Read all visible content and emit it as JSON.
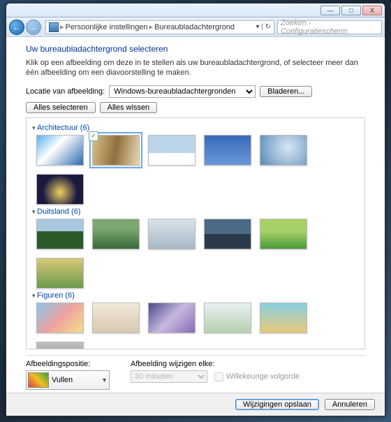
{
  "titlebar": {
    "min": "—",
    "max": "□",
    "close": "X"
  },
  "nav": {
    "breadcrumb1": "Persoonlijke instellingen",
    "breadcrumb2": "Bureaubladachtergrond",
    "search_placeholder": "Zoeken - Configuratiescherm"
  },
  "page": {
    "title": "Uw bureaubladachtergrond selecteren",
    "subtitle": "Klik op een afbeelding om deze in te stellen als uw bureaubladachtergrond, of selecteer meer dan één afbeelding om een diavoorstelling te maken.",
    "location_label": "Locatie van afbeelding:",
    "location_value": "Windows-bureaubladachtergronden",
    "browse": "Bladeren...",
    "select_all": "Alles selecteren",
    "clear_all": "Alles wissen"
  },
  "categories": [
    {
      "name": "Architectuur (6)",
      "count": 6,
      "selected_index": 1,
      "cls": [
        "t-arch1",
        "t-arch2",
        "t-arch3",
        "t-arch4",
        "t-arch5",
        "t-arch6"
      ]
    },
    {
      "name": "Duitsland (6)",
      "count": 6,
      "selected_index": -1,
      "cls": [
        "t-de1",
        "t-de2",
        "t-de3",
        "t-de4",
        "t-de5",
        "t-de6"
      ]
    },
    {
      "name": "Figuren (6)",
      "count": 6,
      "selected_index": -1,
      "cls": [
        "t-fig1",
        "t-fig2",
        "t-fig3",
        "t-fig4",
        "t-fig5",
        "t-fig6"
      ]
    }
  ],
  "bottom": {
    "position_label": "Afbeeldingspositie:",
    "position_value": "Vullen",
    "change_label": "Afbeelding wijzigen elke:",
    "interval_value": "30 minuten",
    "shuffle_label": "Willekeurige volgorde"
  },
  "footer": {
    "save": "Wijzigingen opslaan",
    "cancel": "Annuleren"
  }
}
